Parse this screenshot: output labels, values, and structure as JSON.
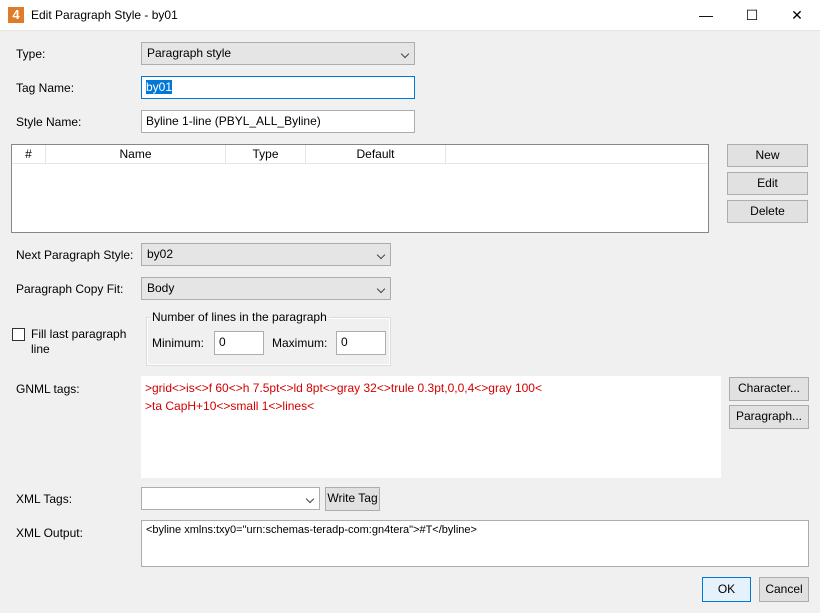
{
  "window": {
    "title": "Edit Paragraph Style - by01",
    "app_icon": "4",
    "minimize": "—",
    "maximize": "☐",
    "close": "✕"
  },
  "type": {
    "label": "Type:",
    "value": "Paragraph style"
  },
  "tag_name": {
    "label": "Tag Name:",
    "value": "by01"
  },
  "style_name": {
    "label": "Style Name:",
    "value": "Byline 1-line (PBYL_ALL_Byline)"
  },
  "table": {
    "columns": [
      "#",
      "Name",
      "Type",
      "Default"
    ]
  },
  "table_buttons": {
    "new": "New",
    "edit": "Edit",
    "delete": "Delete"
  },
  "next_paragraph_style": {
    "label": "Next Paragraph Style:",
    "value": "by02"
  },
  "paragraph_copy_fit": {
    "label": "Paragraph Copy Fit:",
    "value": "Body"
  },
  "fill_last_line": {
    "label_1": "Fill last paragraph",
    "label_2": "line",
    "checked": false
  },
  "lines_group": {
    "title": "Number of lines in the paragraph",
    "minimum_label": "Minimum:",
    "minimum_value": "0",
    "maximum_label": "Maximum:",
    "maximum_value": "0"
  },
  "gnml": {
    "label": "GNML tags:",
    "line_1": ">grid<>is<>f 60<>h 7.5pt<>ld 8pt<>gray 32<>trule 0.3pt,0,0,4<>gray 100<",
    "line_2": ">ta CapH+10<>small 1<>lines<",
    "text_color": "#d40000",
    "character_button": "Character...",
    "paragraph_button": "Paragraph..."
  },
  "xml_tags": {
    "label": "XML Tags:",
    "value": "",
    "write_tag_button": "Write Tag"
  },
  "xml_output": {
    "label": "XML Output:",
    "value": "<byline xmlns:txy0=\"urn:schemas-teradp-com:gn4tera\">#T</byline>"
  },
  "footer": {
    "ok": "OK",
    "cancel": "Cancel"
  },
  "colors": {
    "accent": "#0078d7",
    "app_icon": "#e07b2a"
  }
}
